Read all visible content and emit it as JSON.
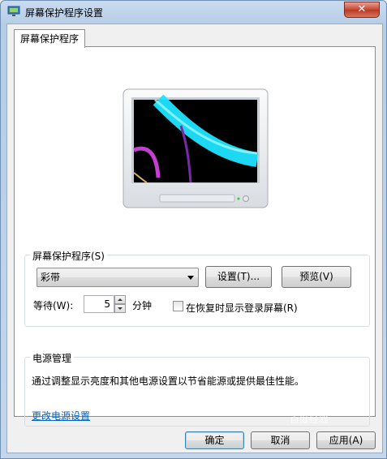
{
  "window": {
    "title": "屏幕保护程序设置",
    "close_label": "✕"
  },
  "tab": {
    "label": "屏幕保护程序"
  },
  "screensaver": {
    "group_label": "屏幕保护程序(S)",
    "selected": "彩带",
    "settings_button": "设置(T)...",
    "preview_button": "预览(V)",
    "wait_label": "等待(W):",
    "wait_value": "5",
    "wait_unit": "分钟",
    "resume_checkbox_label": "在恢复时显示登录屏幕(R)",
    "resume_checked": false
  },
  "power": {
    "group_label": "电源管理",
    "description": "通过调整显示亮度和其他电源设置以节省能源或提供最佳性能。",
    "link_label": "更改电源设置"
  },
  "buttons": {
    "ok": "确定",
    "cancel": "取消",
    "apply": "应用(A)"
  },
  "watermark": "百度经验",
  "colors": {
    "accent_link": "#0066cc",
    "titlebar": "#c3d6ec",
    "close": "#c7462f",
    "preview_ribbon": "#22d6f0"
  }
}
